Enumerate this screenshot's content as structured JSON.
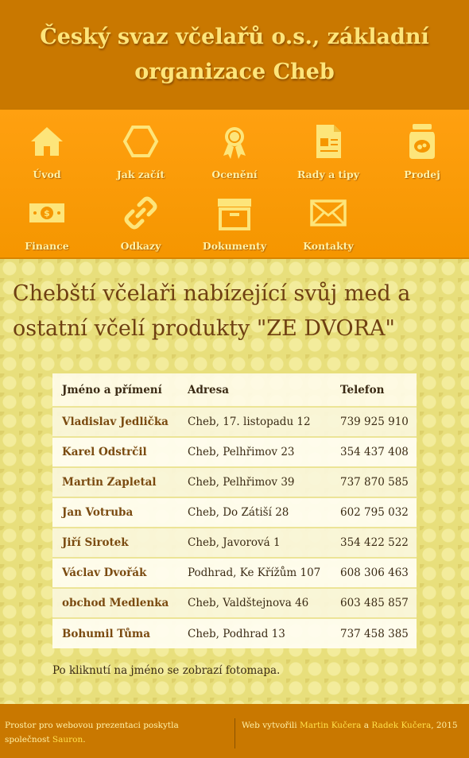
{
  "header": {
    "title": "Český svaz včelařů o.s., základní organizace Cheb"
  },
  "nav": {
    "items": [
      {
        "label": "Úvod",
        "icon": "home-icon"
      },
      {
        "label": "Jak začít",
        "icon": "hexagon-icon"
      },
      {
        "label": "Ocenění",
        "icon": "medal-icon"
      },
      {
        "label": "Rady a tipy",
        "icon": "document-icon"
      },
      {
        "label": "Prodej",
        "icon": "honey-jar-icon"
      },
      {
        "label": "Finance",
        "icon": "banknote-icon"
      },
      {
        "label": "Odkazy",
        "icon": "link-icon"
      },
      {
        "label": "Dokumenty",
        "icon": "archive-box-icon"
      },
      {
        "label": "Kontakty",
        "icon": "envelope-icon"
      }
    ]
  },
  "main": {
    "heading": "Chebští včelaři nabízející svůj med a ostatní včelí produkty \"ZE DVORA\"",
    "table": {
      "headers": [
        "Jméno a přímení",
        "Adresa",
        "Telefon"
      ],
      "rows": [
        [
          "Vladislav Jedlička",
          "Cheb, 17. listopadu 12",
          "739 925 910"
        ],
        [
          "Karel Odstrčil",
          "Cheb, Pelhřimov 23",
          "354 437 408"
        ],
        [
          "Martin Zapletal",
          "Cheb, Pelhřimov 39",
          "737 870 585"
        ],
        [
          "Jan Votruba",
          "Cheb, Do Zátiší 28",
          "602 795 032"
        ],
        [
          "Jiří Sirotek",
          "Cheb, Javorová 1",
          "354 422 522"
        ],
        [
          "Václav Dvořák",
          "Podhrad, Ke Křížům 107",
          "608 306 463"
        ],
        [
          "obchod Medlenka",
          "Cheb, Valdštejnova 46",
          "603 485 857"
        ],
        [
          "Bohumil Tůma",
          "Cheb, Podhrad 13",
          "737 458 385"
        ]
      ]
    },
    "note": "Po kliknutí na jméno se zobrazí fotomapa."
  },
  "footer": {
    "left_text": "Prostor pro webovou prezentaci poskytla společnost",
    "left_link": "Sauron",
    "left_end": ".",
    "right_text": "Web vytvořili",
    "author1": "Martin Kučera",
    "and": "a",
    "author2": "Radek Kučera",
    "year": ", 2015"
  },
  "colors": {
    "header": "#c97800",
    "nav": "#f59600",
    "icon": "#fde57a",
    "heading": "#6e3f12",
    "link": "#7a4a10"
  }
}
